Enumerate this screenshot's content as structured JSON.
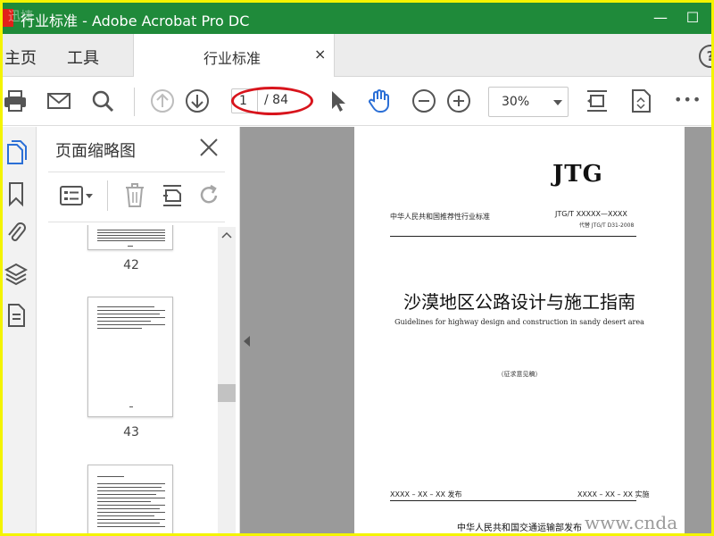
{
  "window": {
    "title": "行业标准 - Adobe Acrobat Pro DC",
    "minimize_glyph": "—",
    "maximize_glyph": "☐",
    "close_glyph": "✕"
  },
  "tabs": {
    "home": "主页",
    "tools": "工具",
    "document": "行业标准",
    "document_close": "×",
    "help": "?"
  },
  "toolbar": {
    "page_current": "1",
    "page_total": "/ 84",
    "zoom": "30%",
    "more": "•••"
  },
  "thumbnails_panel": {
    "title": "页面缩略图",
    "pages": [
      {
        "label": "42"
      },
      {
        "label": "43"
      }
    ]
  },
  "document_page": {
    "logo": "JTG",
    "standard_category": "中华人民共和国推荐性行业标准",
    "standard_number": "JTG/T XXXXX—XXXX",
    "replaces": "代替 JTG/T D31-2008",
    "title": "沙漠地区公路设计与施工指南",
    "subtitle": "Guidelines for highway design and construction in sandy desert area",
    "draft_note": "（征求意见稿）",
    "publish_date": "XXXX – XX – XX 发布",
    "effective_date": "XXXX – XX – XX 实施",
    "publisher": "中华人民共和国交通运输部发布"
  },
  "watermark": {
    "url": "www.cnda",
    "corner": "迅捷"
  },
  "colors": {
    "title_bar": "#1f8a3a",
    "frame_highlight": "#f4f400",
    "page_indicator_circle": "#d8141c",
    "accent_blue": "#2b6fd6"
  }
}
